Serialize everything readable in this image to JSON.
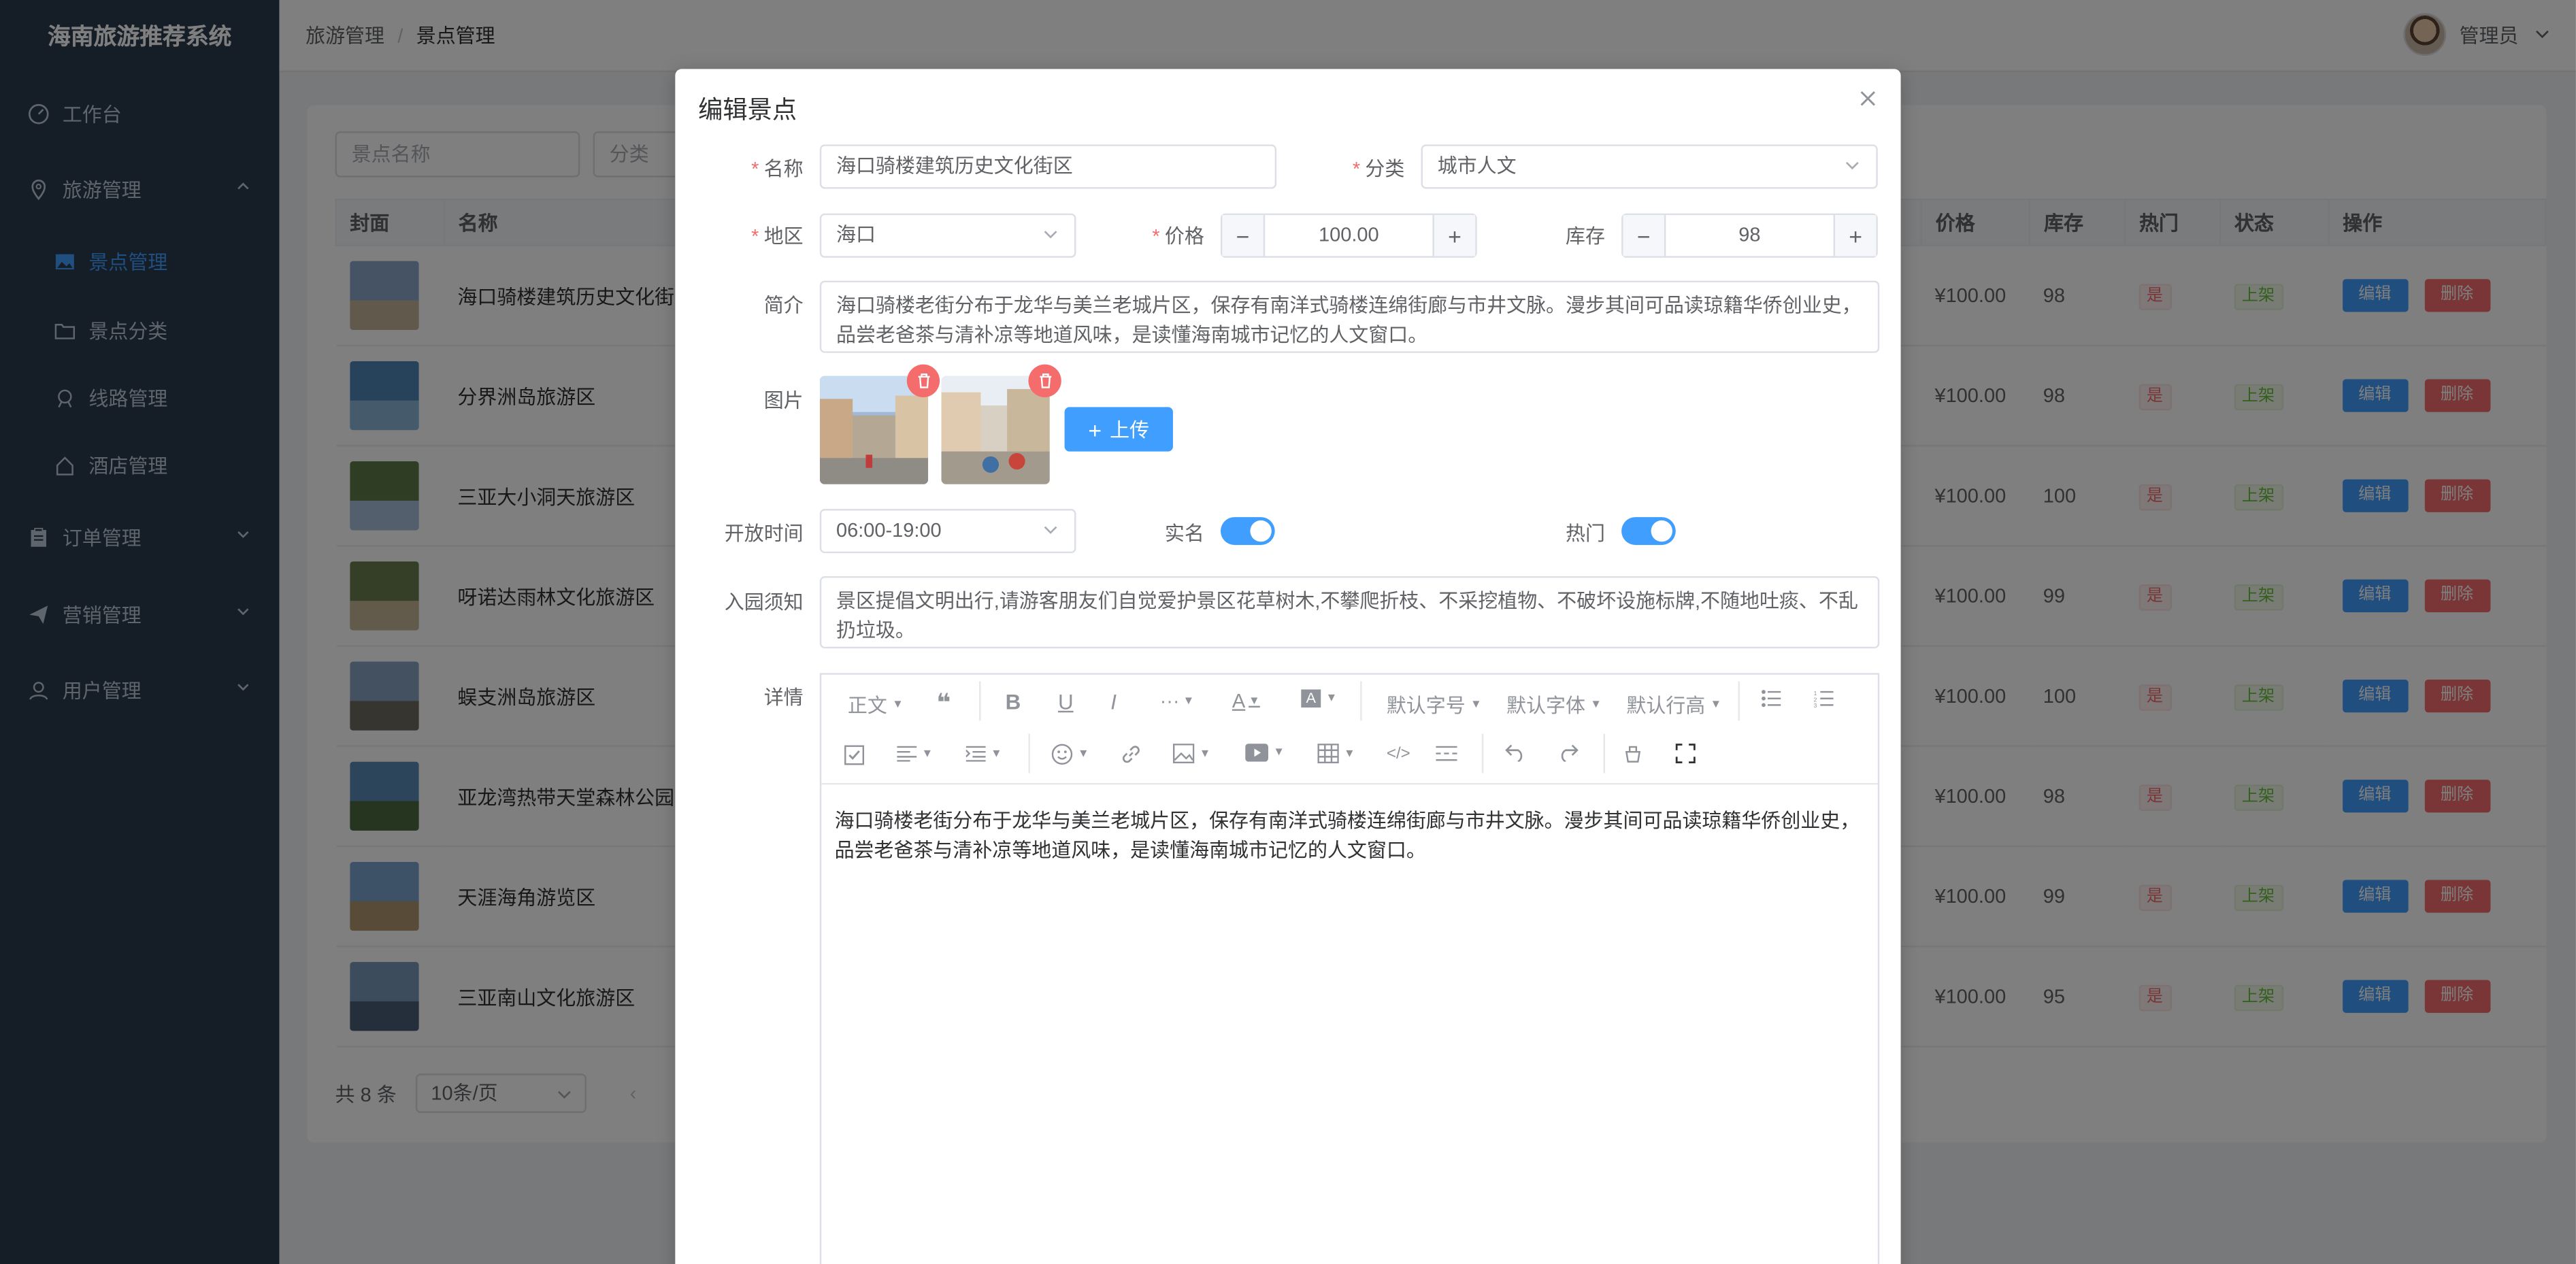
{
  "sidebar": {
    "brand": "海南旅游推荐系统",
    "items": [
      {
        "label": "工作台"
      },
      {
        "label": "旅游管理"
      },
      {
        "label": "景点管理"
      },
      {
        "label": "景点分类"
      },
      {
        "label": "线路管理"
      },
      {
        "label": "酒店管理"
      },
      {
        "label": "订单管理"
      },
      {
        "label": "营销管理"
      },
      {
        "label": "用户管理"
      }
    ]
  },
  "header": {
    "breadcrumb": [
      "旅游管理",
      "景点管理"
    ],
    "separator": "/",
    "user": "管理员"
  },
  "filters": {
    "name_placeholder": "景点名称",
    "category_placeholder": "分类"
  },
  "table": {
    "headers": [
      "封面",
      "名称",
      "价格",
      "库存",
      "热门",
      "状态",
      "操作"
    ],
    "rows": [
      {
        "name": "海口骑楼建筑历史文化街区",
        "price": "¥100.00",
        "stock": "98",
        "hot": "是",
        "status": "上架"
      },
      {
        "name": "分界洲岛旅游区",
        "price": "¥100.00",
        "stock": "98",
        "hot": "是",
        "status": "上架"
      },
      {
        "name": "三亚大小洞天旅游区",
        "price": "¥100.00",
        "stock": "100",
        "hot": "是",
        "status": "上架"
      },
      {
        "name": "呀诺达雨林文化旅游区",
        "price": "¥100.00",
        "stock": "99",
        "hot": "是",
        "status": "上架"
      },
      {
        "name": "蜈支洲岛旅游区",
        "price": "¥100.00",
        "stock": "100",
        "hot": "是",
        "status": "上架"
      },
      {
        "name": "亚龙湾热带天堂森林公园",
        "price": "¥100.00",
        "stock": "98",
        "hot": "是",
        "status": "上架"
      },
      {
        "name": "天涯海角游览区",
        "price": "¥100.00",
        "stock": "99",
        "hot": "是",
        "status": "上架"
      },
      {
        "name": "三亚南山文化旅游区",
        "price": "¥100.00",
        "stock": "95",
        "hot": "是",
        "status": "上架"
      }
    ],
    "edit_label": "编辑",
    "delete_label": "删除"
  },
  "pager": {
    "total": "共 8 条",
    "page_size": "10条/页"
  },
  "dialog": {
    "title": "编辑景点",
    "name_label": "名称",
    "name_value": "海口骑楼建筑历史文化街区",
    "category_label": "分类",
    "category_value": "城市人文",
    "region_label": "地区",
    "region_value": "海口",
    "price_label": "价格",
    "price_value": "100.00",
    "stock_label": "库存",
    "stock_value": "98",
    "intro_label": "简介",
    "intro_value": "海口骑楼老街分布于龙华与美兰老城片区，保存有南洋式骑楼连绵街廊与市井文脉。漫步其间可品读琼籍华侨创业史，品尝老爸茶与清补凉等地道风味，是读懂海南城市记忆的人文窗口。",
    "images_label": "图片",
    "upload_label": "上传",
    "open_time_label": "开放时间",
    "open_time_value": "06:00-19:00",
    "realname_label": "实名",
    "realname_on": true,
    "hot_label": "热门",
    "hot_on": true,
    "notice_label": "入园须知",
    "notice_value": "景区提倡文明出行,请游客朋友们自觉爱护景区花草树木,不攀爬折枝、不采挖植物、不破坏设施标牌,不随地吐痰、不乱扔垃圾。",
    "detail_label": "详情",
    "editor": {
      "heading_select": "正文",
      "font_size_select": "默认字号",
      "font_family_select": "默认字体",
      "line_height_select": "默认行高",
      "body": "海口骑楼老街分布于龙华与美兰老城片区，保存有南洋式骑楼连绵街廊与市井文脉。漫步其间可品读琼籍华侨创业史，品尝老爸茶与清补凉等地道风味，是读懂海南城市记忆的人文窗口。"
    }
  },
  "colors": {
    "sidebar_bg": "#2b3a4f",
    "primary": "#409eff",
    "danger": "#f56c6c",
    "success": "#67c23a"
  }
}
